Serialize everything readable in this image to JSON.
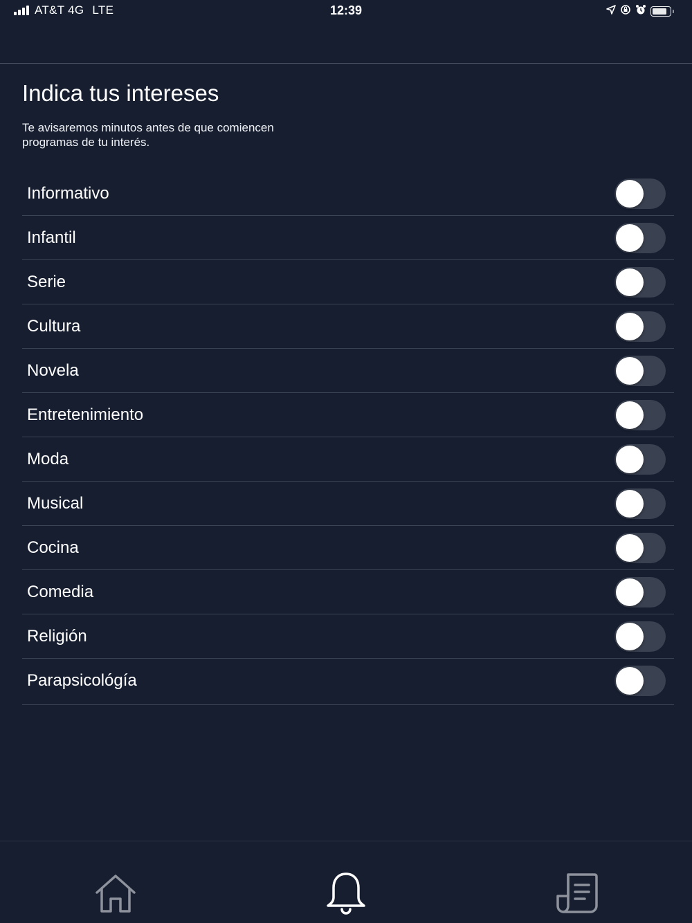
{
  "status_bar": {
    "carrier": "AT&T 4G",
    "network": "LTE",
    "time": "12:39"
  },
  "header": {
    "title": "Indica tus intereses",
    "subtitle": "Te avisaremos minutos antes de que comiencen programas de tu interés."
  },
  "interests": [
    {
      "label": "Informativo",
      "enabled": false
    },
    {
      "label": "Infantil",
      "enabled": false
    },
    {
      "label": "Serie",
      "enabled": false
    },
    {
      "label": "Cultura",
      "enabled": false
    },
    {
      "label": "Novela",
      "enabled": false
    },
    {
      "label": "Entretenimiento",
      "enabled": false
    },
    {
      "label": "Moda",
      "enabled": false
    },
    {
      "label": "Musical",
      "enabled": false
    },
    {
      "label": "Cocina",
      "enabled": false
    },
    {
      "label": "Comedia",
      "enabled": false
    },
    {
      "label": "Religión",
      "enabled": false
    },
    {
      "label": "Parapsicológía",
      "enabled": false
    }
  ],
  "tab_bar": {
    "tabs": [
      {
        "icon": "home-icon",
        "active": false
      },
      {
        "icon": "bell-icon",
        "active": true
      },
      {
        "icon": "document-icon",
        "active": false
      }
    ]
  },
  "colors": {
    "background": "#161e30",
    "toggle_track_off": "#3a4150",
    "toggle_knob": "#ffffff",
    "divider": "#3b4454",
    "tab_icon_inactive": "#8d929c",
    "tab_icon_active": "#ffffff"
  }
}
